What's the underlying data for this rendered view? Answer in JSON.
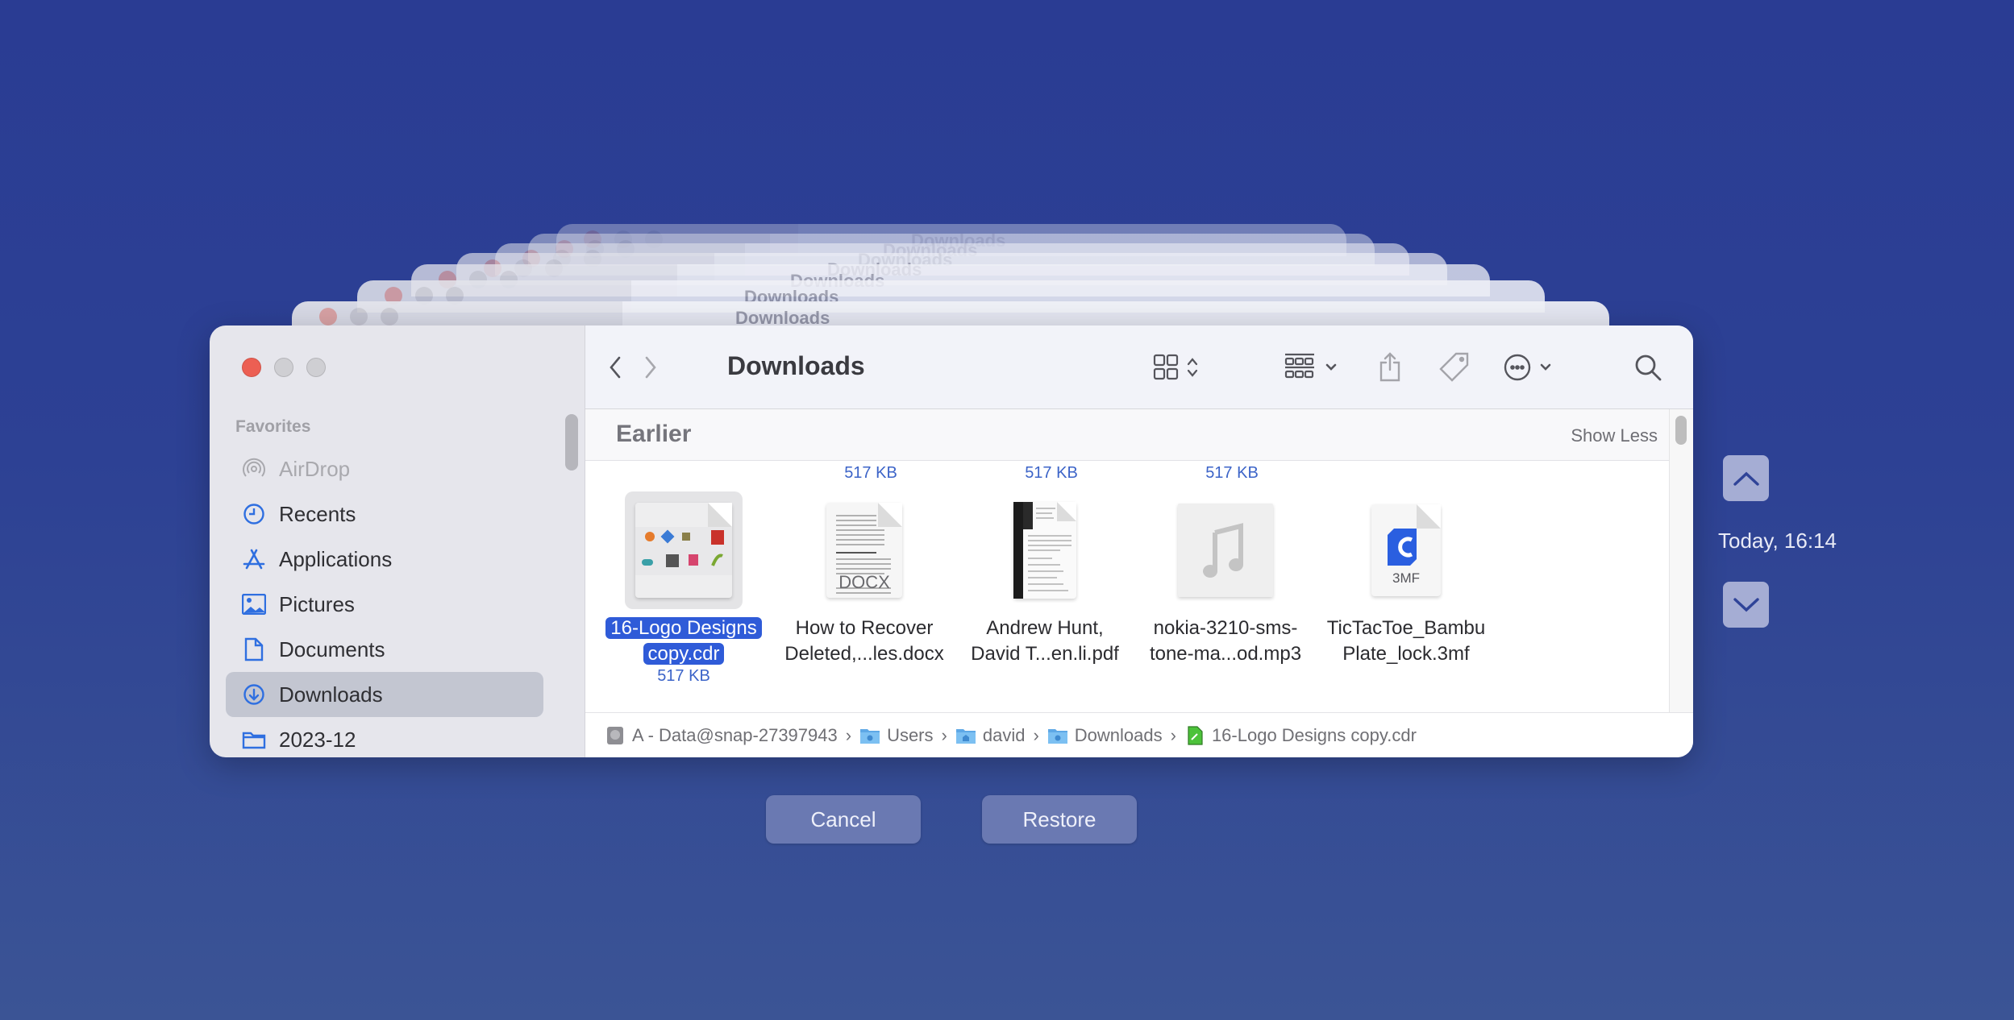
{
  "window": {
    "title": "Downloads",
    "traffic_lights": [
      "close",
      "minimize",
      "zoom"
    ]
  },
  "sidebar": {
    "section_label": "Favorites",
    "items": [
      {
        "label": "AirDrop",
        "icon": "airdrop-icon",
        "state": "disabled"
      },
      {
        "label": "Recents",
        "icon": "clock-icon",
        "state": "normal"
      },
      {
        "label": "Applications",
        "icon": "applications-icon",
        "state": "normal"
      },
      {
        "label": "Pictures",
        "icon": "photo-icon",
        "state": "normal"
      },
      {
        "label": "Documents",
        "icon": "document-icon",
        "state": "normal"
      },
      {
        "label": "Downloads",
        "icon": "download-circle-icon",
        "state": "selected"
      },
      {
        "label": "2023-12",
        "icon": "folder-icon",
        "state": "normal"
      }
    ]
  },
  "toolbar": {
    "back_icon": "chevron-left-icon",
    "forward_icon": "chevron-right-icon",
    "title": "Downloads",
    "view_icon": "icon-grid-view-icon",
    "group_icon": "group-by-icon",
    "share_icon": "share-icon",
    "tag_icon": "tag-icon",
    "more_icon": "ellipsis-circle-icon",
    "search_icon": "search-icon"
  },
  "section": {
    "title": "Earlier",
    "toggle_label": "Show Less"
  },
  "top_row_sizes": [
    "517 KB",
    "517 KB",
    "517 KB"
  ],
  "files": [
    {
      "name": "16-Logo Designs copy.cdr",
      "name_line1": "16-Logo Designs",
      "name_line2": "copy.cdr",
      "size": "517 KB",
      "type": "cdr",
      "selected": true
    },
    {
      "name": "How to Recover Deleted,...les.docx",
      "name_line1": "How to Recover",
      "name_line2": "Deleted,...les.docx",
      "type": "docx",
      "badge": "DOCX",
      "selected": false
    },
    {
      "name": "Andrew Hunt, David T...en.li.pdf",
      "name_line1": "Andrew Hunt,",
      "name_line2": "David T...en.li.pdf",
      "type": "pdf",
      "selected": false
    },
    {
      "name": "nokia-3210-sms-tone-ma...od.mp3",
      "name_line1": "nokia-3210-sms-",
      "name_line2": "tone-ma...od.mp3",
      "type": "mp3",
      "selected": false
    },
    {
      "name": "TicTacToe_Bambu Plate_lock.3mf",
      "name_line1": "TicTacToe_Bambu",
      "name_line2": "Plate_lock.3mf",
      "type": "3mf",
      "badge": "3MF",
      "selected": false
    }
  ],
  "path_bar": [
    {
      "label": "A - Data@snap-27397943",
      "icon": "hard-drive-icon"
    },
    {
      "label": "Users",
      "icon": "users-folder-icon"
    },
    {
      "label": "david",
      "icon": "home-folder-icon"
    },
    {
      "label": "Downloads",
      "icon": "downloads-folder-icon"
    },
    {
      "label": "16-Logo Designs copy.cdr",
      "icon": "cdr-file-icon"
    }
  ],
  "ghost_title": "Downloads",
  "time_machine": {
    "date_label": "Today, 16:14",
    "up_icon": "chevron-up-icon",
    "down_icon": "chevron-down-icon"
  },
  "actions": {
    "cancel_label": "Cancel",
    "restore_label": "Restore"
  },
  "colors": {
    "background_top": "#2a3c93",
    "background_bottom": "#3b5495",
    "selection": "#2f5bd8",
    "accent_blue": "#2f6fe0",
    "close_red": "#ec5f53",
    "size_text": "#3c64c8"
  }
}
